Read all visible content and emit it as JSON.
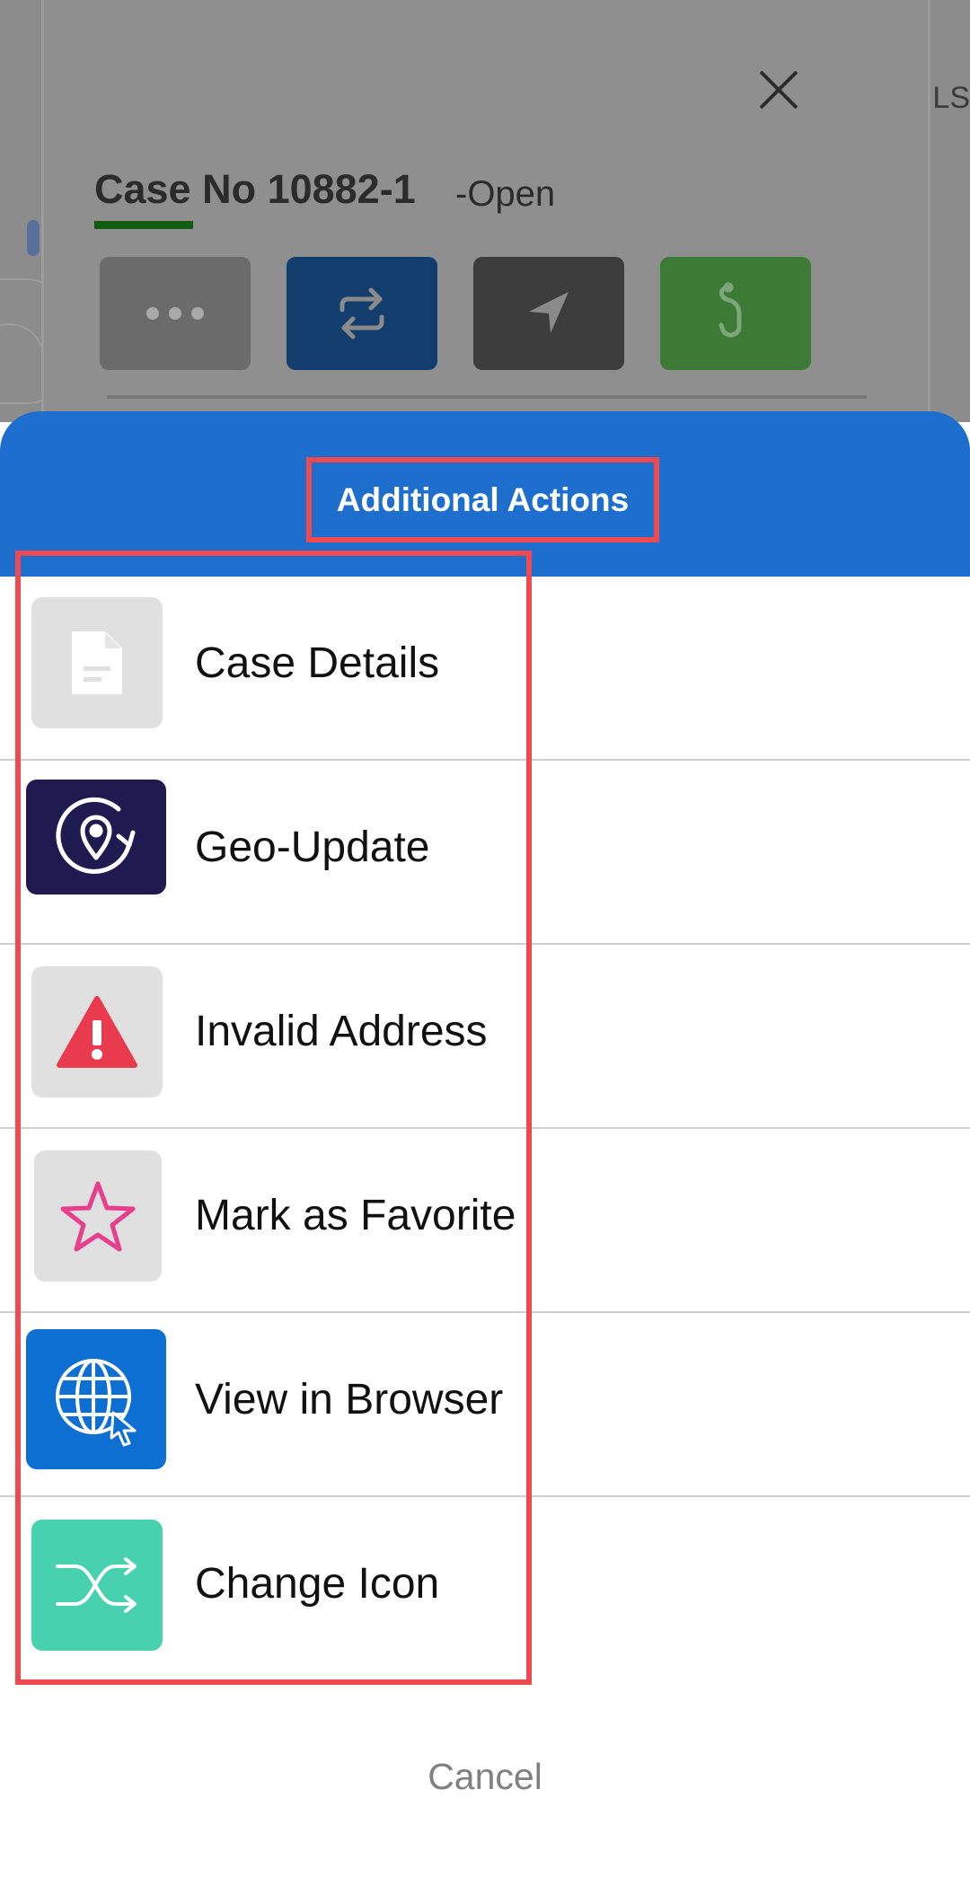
{
  "background": {
    "map_label": "LS",
    "case": {
      "title": "Case No 10882-1",
      "status": "-Open"
    },
    "action_buttons": [
      {
        "name": "more-options",
        "icon": "more-dots-icon",
        "color": "#6b6b6b"
      },
      {
        "name": "swap",
        "icon": "swap-arrows-icon",
        "color": "#123e6e"
      },
      {
        "name": "navigate",
        "icon": "navigation-arrow-icon",
        "color": "#3c3c3c"
      },
      {
        "name": "hook",
        "icon": "hook-icon",
        "color": "#3b7b36"
      }
    ]
  },
  "sheet": {
    "title": "Additional Actions",
    "header_color": "#1e6fcd",
    "items": [
      {
        "label": "Case Details",
        "icon": "document-icon",
        "icon_bg": "#e0e0e0"
      },
      {
        "label": "Geo-Update",
        "icon": "geo-update-icon",
        "icon_bg": "#1f1a4f"
      },
      {
        "label": "Invalid Address",
        "icon": "warning-icon",
        "icon_bg": "#e0e0e0"
      },
      {
        "label": "Mark as Favorite",
        "icon": "star-icon",
        "icon_bg": "#e0e0e0"
      },
      {
        "label": "View in Browser",
        "icon": "globe-icon",
        "icon_bg": "#0d6fd1"
      },
      {
        "label": "Change Icon",
        "icon": "shuffle-icon",
        "icon_bg": "#48d1ae"
      }
    ],
    "cancel_label": "Cancel"
  },
  "highlight_color": "#ef4a4f"
}
